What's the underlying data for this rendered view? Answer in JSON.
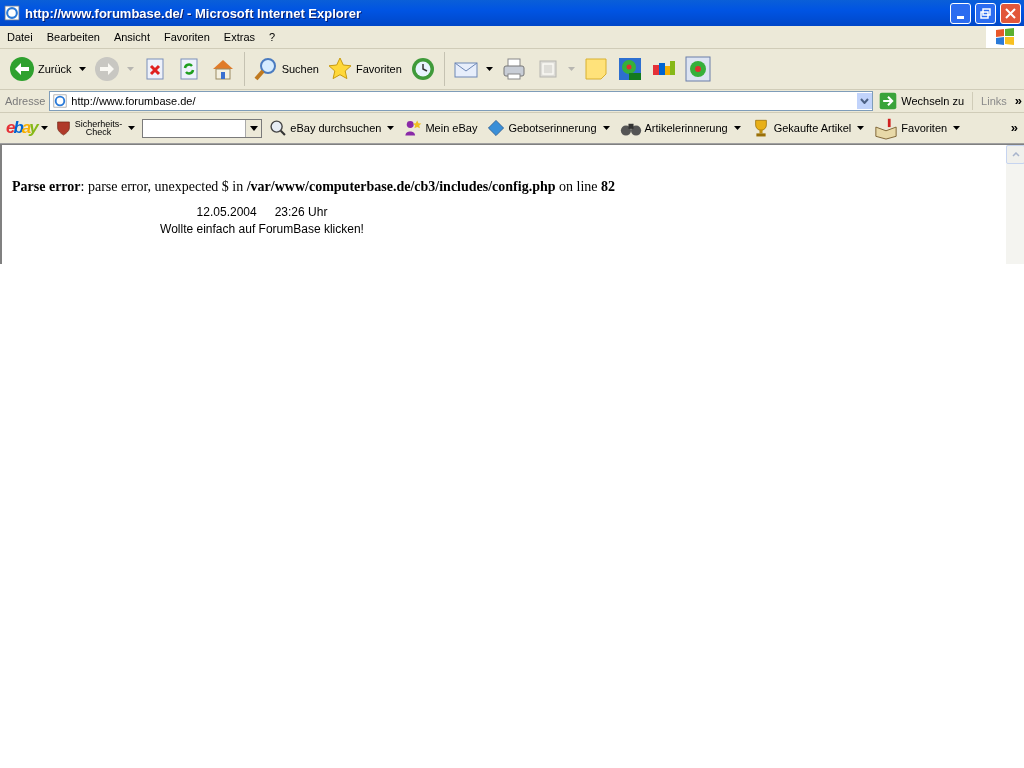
{
  "window": {
    "title": "http://www.forumbase.de/ - Microsoft Internet Explorer"
  },
  "menu": [
    "Datei",
    "Bearbeiten",
    "Ansicht",
    "Favoriten",
    "Extras",
    "?"
  ],
  "toolbar": [
    {
      "label": "Zurück",
      "dropdown": true,
      "disabled": false
    },
    {
      "dropdown": true,
      "disabled": true
    },
    {
      "dropdown": false,
      "disabled": false
    },
    {
      "dropdown": false,
      "disabled": false
    },
    {
      "dropdown": false,
      "disabled": false
    },
    {
      "label": "Suchen",
      "dropdown": false,
      "disabled": false
    },
    {
      "label": "Favoriten",
      "dropdown": false,
      "disabled": false
    },
    {
      "dropdown": false,
      "disabled": false
    },
    {
      "dropdown": true,
      "disabled": false
    },
    {
      "dropdown": false,
      "disabled": false
    },
    {
      "dropdown": true,
      "disabled": true
    },
    {
      "dropdown": false,
      "disabled": false
    },
    {
      "dropdown": false,
      "disabled": false
    },
    {
      "dropdown": false,
      "disabled": false
    },
    {
      "dropdown": false,
      "disabled": false
    }
  ],
  "address": {
    "label": "Adresse",
    "value": "http://www.forumbase.de/",
    "go": "Wechseln zu",
    "links": "Links",
    "more": "»"
  },
  "ebay_toolbar": {
    "logo": "ebay",
    "items": [
      {
        "label": "Sicherheits-Check",
        "dropdown": true
      },
      {
        "label": "eBay durchsuchen",
        "dropdown": true
      },
      {
        "label": "Mein eBay",
        "dropdown": false
      },
      {
        "label": "Gebotserinnerung",
        "dropdown": true
      },
      {
        "label": "Artikelerinnerung",
        "dropdown": true
      },
      {
        "label": "Gekaufte Artikel",
        "dropdown": true
      },
      {
        "label": "Favoriten",
        "dropdown": true
      }
    ],
    "more": "»"
  },
  "page": {
    "error": "**Parse error**: parse error, unexpected $ in **/var/www/computerbase.de/cb3/includes/config.php** on line **82**",
    "date": "12.05.2004",
    "time": "23:26 Uhr",
    "message": "Wollte einfach auf ForumBase klicken!"
  }
}
